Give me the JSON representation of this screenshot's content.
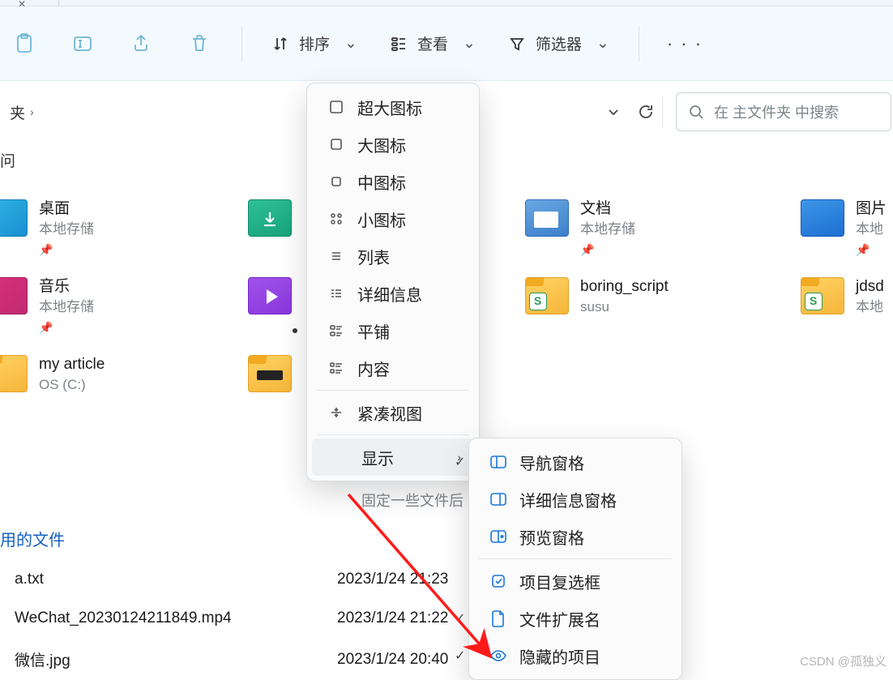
{
  "toolbar": {
    "sort": "排序",
    "view": "查看",
    "filter": "筛选器"
  },
  "breadcrumb": {
    "current": "夹"
  },
  "search": {
    "placeholder": "在 主文件夹 中搜索"
  },
  "quick_access_header": "问",
  "items": {
    "desktop": {
      "name": "桌面",
      "sub": "本地存储"
    },
    "music": {
      "name": "音乐",
      "sub": "本地存储"
    },
    "myarticle": {
      "name": "my article",
      "sub": "OS (C:)"
    },
    "downloads": {
      "name": "",
      "sub": ""
    },
    "videos": {
      "name": "",
      "sub": ""
    },
    "folder3": {
      "name": "",
      "sub": ""
    },
    "docs": {
      "name": "文档",
      "sub": "本地存储"
    },
    "boring": {
      "name": "boring_script",
      "sub": "susu"
    },
    "pics": {
      "name": "图片",
      "sub": "本地"
    },
    "jdsd": {
      "name": "jdsd",
      "sub": "本地"
    }
  },
  "view_menu": {
    "xl": "超大图标",
    "lg": "大图标",
    "md": "中图标",
    "sm": "小图标",
    "list": "列表",
    "details": "详细信息",
    "tiles": "平铺",
    "content": "内容",
    "compact": "紧凑视图",
    "show": "显示"
  },
  "show_submenu": {
    "nav": "导航窗格",
    "details": "详细信息窗格",
    "preview": "预览窗格",
    "checkboxes": "项目复选框",
    "ext": "文件扩展名",
    "hidden": "隐藏的项目"
  },
  "pinned_hint": "固定一些文件后",
  "recent": {
    "header": "用的文件",
    "rows": [
      {
        "name": "a.txt",
        "date": "2023/1/24 21:23"
      },
      {
        "name": "WeChat_20230124211849.mp4",
        "date": "2023/1/24 21:22"
      },
      {
        "name": "微信.jpg",
        "date": "2023/1/24 20:40"
      }
    ]
  },
  "watermark": "CSDN @孤独义"
}
